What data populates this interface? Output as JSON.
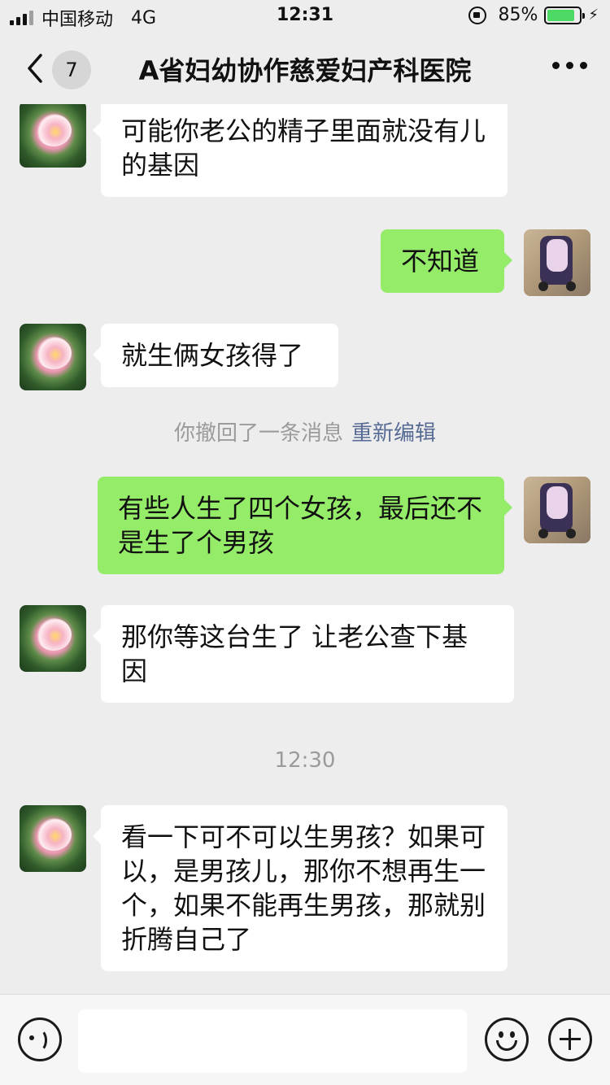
{
  "status_bar": {
    "carrier": "中国移动",
    "network": "4G",
    "time": "12:31",
    "battery_percent": "85%",
    "battery_level": 0.85
  },
  "nav": {
    "unread_count": "7",
    "title": "A省妇幼协作慈爱妇产科医院",
    "back_icon": "chevron-left-icon",
    "more_icon": "more-dots-icon"
  },
  "messages": [
    {
      "side": "in",
      "text": "可能你老公的精子里面就没有儿的基因"
    },
    {
      "side": "out",
      "text": "不知道"
    },
    {
      "side": "in",
      "text": "就生俩女孩得了"
    },
    {
      "side": "out",
      "text": "有些人生了四个女孩，最后还不是生了个男孩"
    },
    {
      "side": "in",
      "text": "那你等这台生了 让老公查下基因"
    },
    {
      "side": "in",
      "text": "看一下可不可以生男孩？如果可以，是男孩儿，那你不想再生一个，如果不能再生男孩，那就别折腾自己了"
    }
  ],
  "system": {
    "recall_text": "你撤回了一条消息",
    "recall_action": "重新编辑",
    "timestamp": "12:30"
  },
  "input_bar": {
    "voice_icon": "voice-icon",
    "emoji_icon": "emoji-icon",
    "plus_icon": "plus-icon",
    "message_value": ""
  },
  "colors": {
    "outgoing_bubble": "#95ec69",
    "incoming_bubble": "#ffffff",
    "background": "#ededed",
    "link": "#576b95"
  }
}
